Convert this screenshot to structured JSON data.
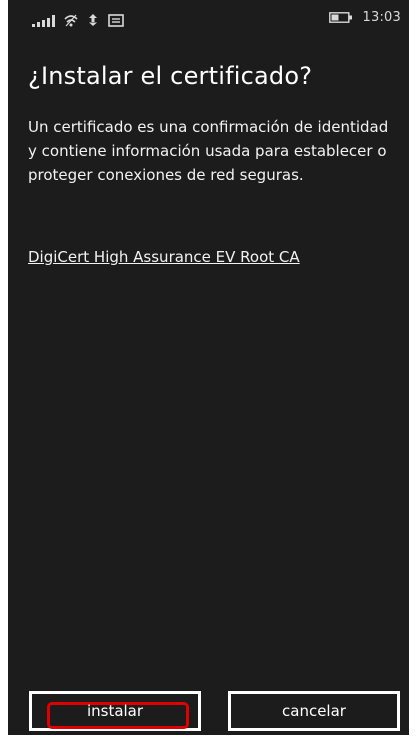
{
  "status_bar": {
    "time": "13:03",
    "icons": [
      "signal-bars-icon",
      "wifi-icon",
      "data-sync-icon",
      "message-icon",
      "battery-icon"
    ]
  },
  "dialog": {
    "title": "¿Instalar el certificado?",
    "description": "Un certificado es una confirmación de identidad y contiene información usada para establecer o proteger conexiones de red seguras.",
    "certificate_name": "DigiCert High Assurance EV Root CA"
  },
  "buttons": {
    "install_label": "instalar",
    "cancel_label": "cancelar"
  },
  "colors": {
    "background": "#1c1c1c",
    "text": "#ffffff",
    "highlight": "#e00000"
  }
}
